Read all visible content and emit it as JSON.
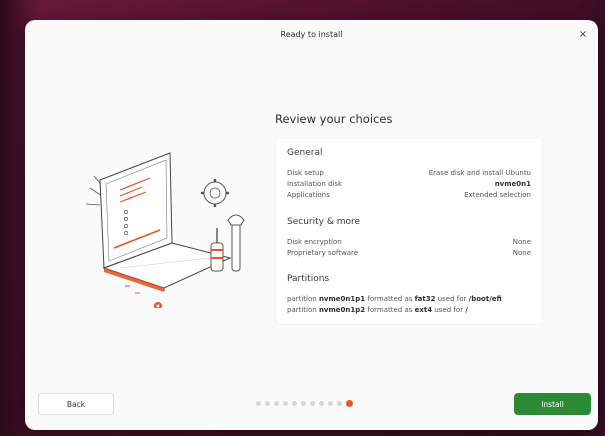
{
  "window": {
    "title": "Ready to install",
    "close_glyph": "×"
  },
  "review": {
    "heading": "Review your choices",
    "general": {
      "title": "General",
      "rows": [
        {
          "label": "Disk setup",
          "value": "Erase disk and install Ubuntu"
        },
        {
          "label": "Installation disk",
          "value": "nvme0n1"
        },
        {
          "label": "Applications",
          "value": "Extended selection"
        }
      ]
    },
    "security": {
      "title": "Security & more",
      "rows": [
        {
          "label": "Disk encryption",
          "value": "None"
        },
        {
          "label": "Proprietary software",
          "value": "None"
        }
      ]
    },
    "partitions": {
      "title": "Partitions",
      "items": [
        {
          "prefix": "partition",
          "device": "nvme0n1p1",
          "mid": "formatted as",
          "fs": "fat32",
          "mid2": "used for",
          "mount": "/boot/efi"
        },
        {
          "prefix": "partition",
          "device": "nvme0n1p2",
          "mid": "formatted as",
          "fs": "ext4",
          "mid2": "used for",
          "mount": "/"
        }
      ]
    }
  },
  "footer": {
    "back_label": "Back",
    "install_label": "Install",
    "pager": {
      "total_steps": 11,
      "current_step": 11
    }
  },
  "colors": {
    "accent": "#e95420",
    "install_green": "#2d8a34",
    "window_bg": "#fafafa"
  },
  "icons": [
    "close-icon",
    "laptop-illustration",
    "gear-icon",
    "wrench-icon"
  ]
}
